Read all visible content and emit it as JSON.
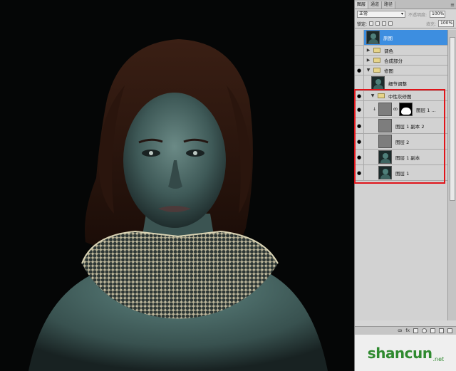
{
  "tabs": [
    "图层",
    "通道",
    "路径"
  ],
  "blend_mode": "正常",
  "opacity_label": "不透明度:",
  "opacity_value": "100%",
  "lock_label": "锁定:",
  "fill_label": "填充:",
  "fill_value": "100%",
  "layers": [
    {
      "name": "原图",
      "type": "layer",
      "visible": false,
      "selected": true
    },
    {
      "name": "调色",
      "type": "group",
      "visible": false
    },
    {
      "name": "合成部分",
      "type": "group",
      "visible": false
    },
    {
      "name": "修图",
      "type": "group",
      "visible": true
    },
    {
      "name": "细节调整",
      "type": "layer",
      "visible": false
    },
    {
      "name": "中性灰修图",
      "type": "group",
      "visible": true
    },
    {
      "name": "图层 1 ...",
      "type": "masked-layer",
      "visible": true
    },
    {
      "name": "图层 1 副本 2",
      "type": "layer",
      "visible": true
    },
    {
      "name": "图层 2",
      "type": "layer",
      "visible": true
    },
    {
      "name": "图层 1 副本",
      "type": "layer",
      "visible": true
    },
    {
      "name": "图层 1",
      "type": "layer",
      "visible": true
    }
  ],
  "bottom_bar_link": "ꝏ",
  "bottom_bar_fx": "fx",
  "logo": {
    "text": "shancun",
    "suffix": ".net"
  },
  "highlight_color": "#e0141a",
  "selection_color": "#3d8ee0"
}
